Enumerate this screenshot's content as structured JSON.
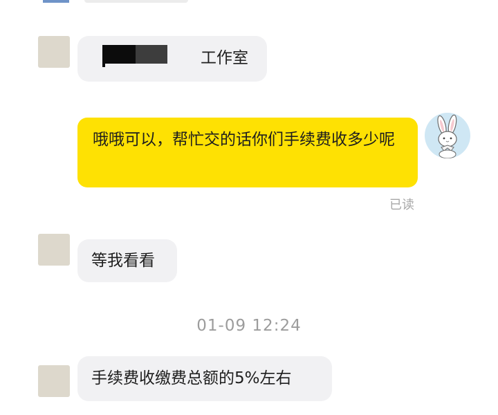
{
  "messages": [
    {
      "sender": "contact",
      "text": "工作室"
    },
    {
      "sender": "me",
      "text": "哦哦可以，帮忙交的话你们手续费收多少呢",
      "status": "已读"
    },
    {
      "sender": "contact",
      "text": "等我看看"
    },
    {
      "sender": "contact",
      "text": "手续费收缴费总额的5%左右"
    }
  ],
  "divider_time": "01-09 12:24",
  "colors": {
    "own_bubble": "#fee103",
    "other_bubble": "#f1f1f3",
    "avatar_bg": "#cfe7f4"
  },
  "icons": {
    "own_avatar": "white-rabbit-icon"
  }
}
